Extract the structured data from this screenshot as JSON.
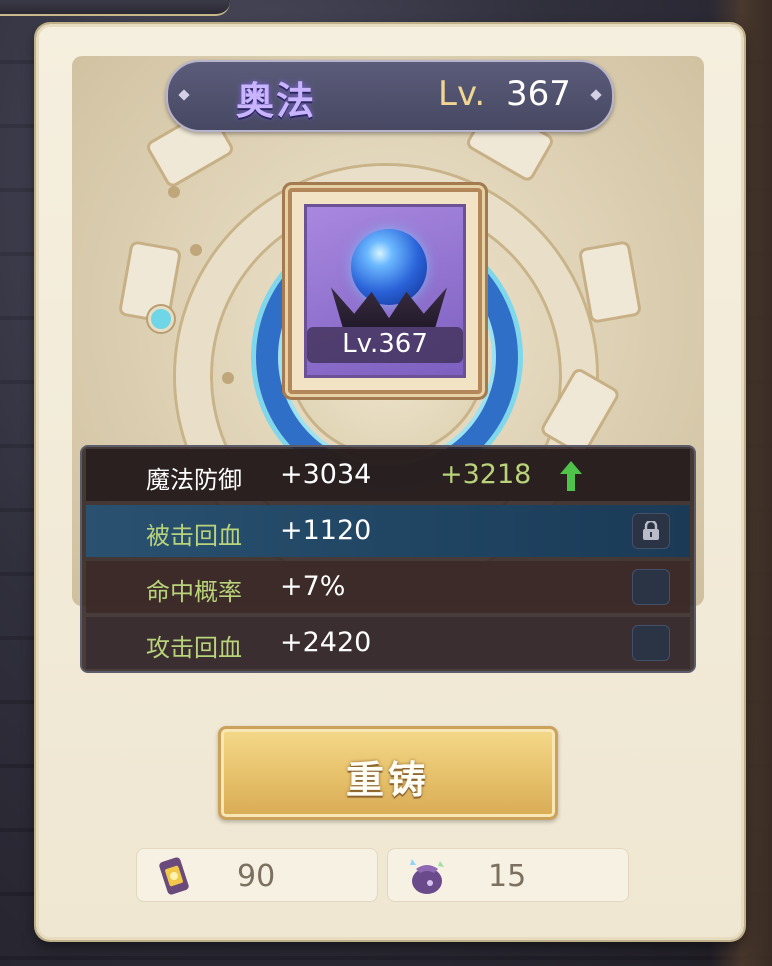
{
  "header": {
    "name": "奥法",
    "level_prefix": "Lv.",
    "level": "367"
  },
  "gem": {
    "icon": "blue-crystal-orb-icon",
    "level_label": "Lv.367"
  },
  "stats": [
    {
      "name": "魔法防御",
      "value": "+3034",
      "new_value": "+3218",
      "trend": "up",
      "name_color": "#ffffff"
    },
    {
      "name": "被击回血",
      "value": "+1120",
      "locked": true,
      "name_color": "#b8d37a"
    },
    {
      "name": "命中概率",
      "value": "+7%",
      "locked": false,
      "name_color": "#b8d37a"
    },
    {
      "name": "攻击回血",
      "value": "+2420",
      "locked": false,
      "name_color": "#b8d37a"
    }
  ],
  "actions": {
    "recast_label": "重铸"
  },
  "resources": [
    {
      "icon": "lantern-scroll-icon",
      "count": "90"
    },
    {
      "icon": "purple-pouch-icon",
      "count": "15"
    }
  ],
  "colors": {
    "accent_gold": "#e6c06a",
    "stat_green": "#b8d37a",
    "title_purple": "#c9b4ff"
  }
}
